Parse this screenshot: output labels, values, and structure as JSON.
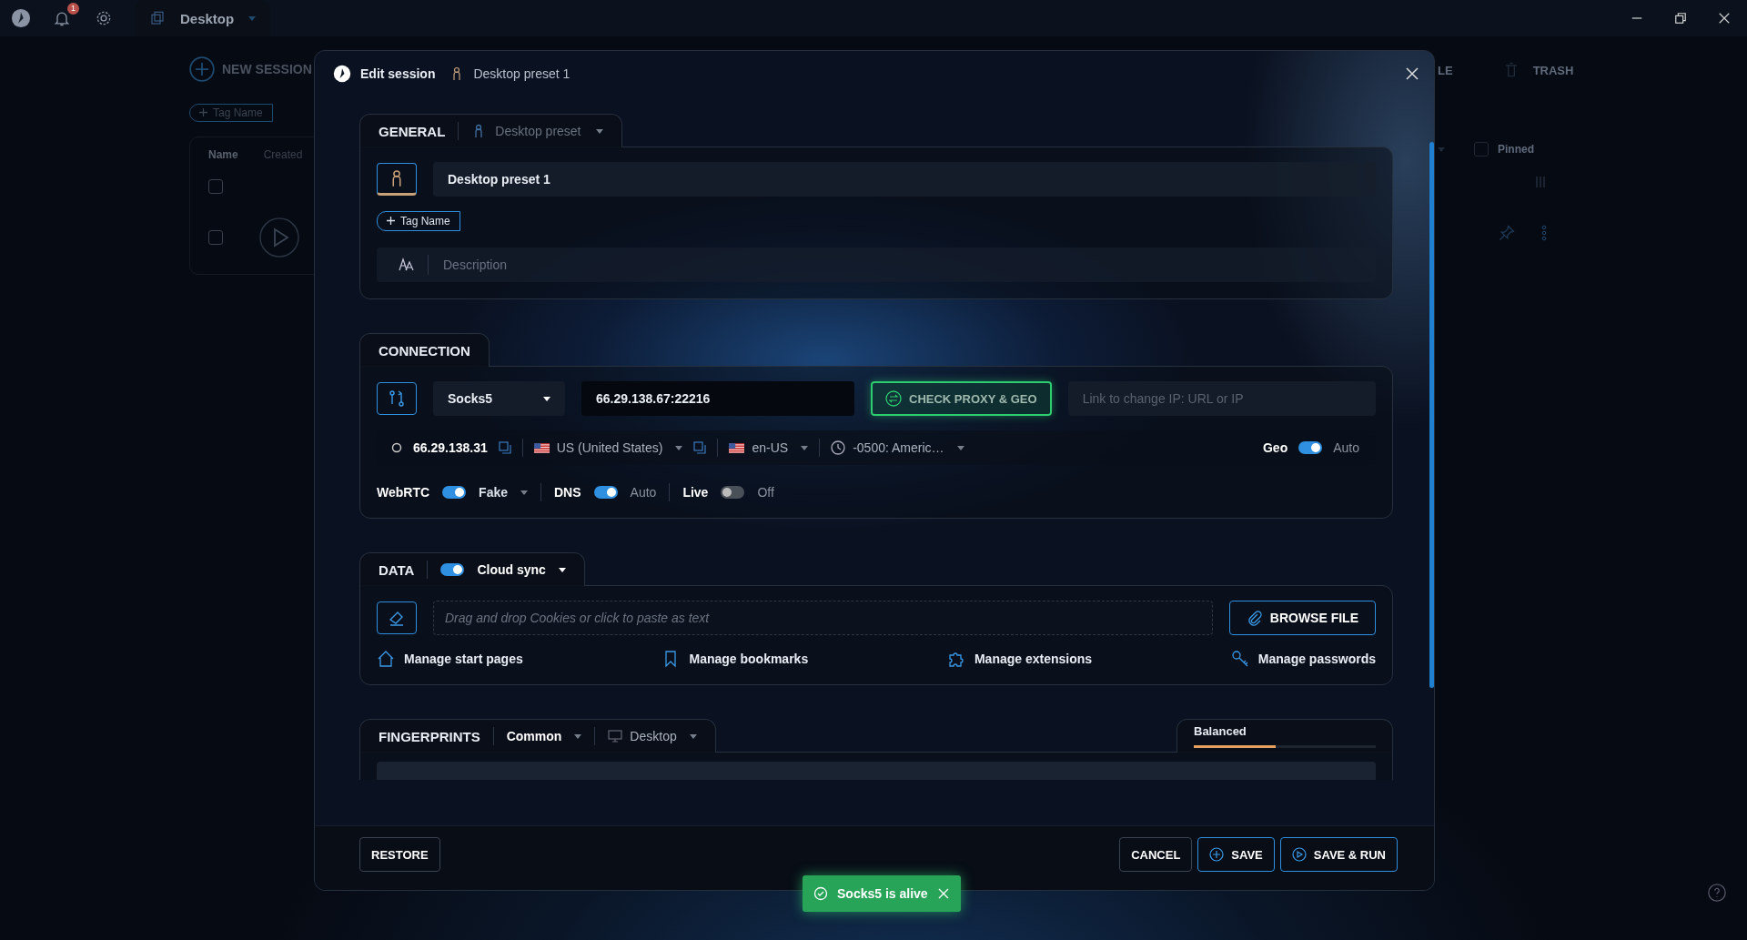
{
  "top_bar": {
    "notification_count": "1",
    "tab_title": "Desktop"
  },
  "background": {
    "new_session": "NEW SESSION",
    "tag_button": "Tag Name",
    "columns": [
      "Name",
      "Created"
    ],
    "rows": [
      {
        "kind": "plain",
        "checked": false
      },
      {
        "kind": "play",
        "checked": false
      }
    ],
    "right_tabs": [
      "LE",
      "TRASH"
    ],
    "pinned": {
      "label": "Pinned",
      "checked": false
    }
  },
  "modal": {
    "title": "Edit session",
    "preset_name": "Desktop preset 1",
    "general": {
      "title": "GENERAL",
      "preset_select": "Desktop preset",
      "name_value": "Desktop preset 1",
      "tag_button": "Tag Name",
      "description_placeholder": "Description"
    },
    "connection": {
      "title": "CONNECTION",
      "proxy_type": "Socks5",
      "proxy_address": "66.29.138.67:22216",
      "check_button": "CHECK PROXY & GEO",
      "change_ip_placeholder": "Link to change IP: URL or IP",
      "ip": "66.29.138.31",
      "country": "US (United States)",
      "language": "en-US",
      "timezone": "-0500: Americ…",
      "geo": {
        "label": "Geo",
        "on": true,
        "value": "Auto"
      },
      "toggles": [
        {
          "label": "WebRTC",
          "on": true,
          "value": "Fake",
          "kind": "dropdown"
        },
        {
          "label": "DNS",
          "on": true,
          "value": "Auto",
          "kind": "plain"
        },
        {
          "label": "Live",
          "on": false,
          "value": "Off",
          "kind": "plain"
        }
      ]
    },
    "data": {
      "title": "DATA",
      "cloud_sync": {
        "label": "Cloud sync",
        "on": true
      },
      "cookies_placeholder": "Drag and drop Cookies or click to paste as text",
      "browse_button": "BROWSE FILE",
      "links": [
        {
          "label": "Manage start pages",
          "kind": "home"
        },
        {
          "label": "Manage bookmarks",
          "kind": "bookmark"
        },
        {
          "label": "Manage extensions",
          "kind": "puzzle"
        },
        {
          "label": "Manage passwords",
          "kind": "key"
        }
      ]
    },
    "fingerprints": {
      "title": "FINGERPRINTS",
      "mode": "Common",
      "device": "Desktop",
      "profile": {
        "label": "Balanced",
        "level": 0.45
      }
    },
    "footer": {
      "restore": "RESTORE",
      "cancel": "CANCEL",
      "save": "SAVE",
      "save_run": "SAVE & RUN"
    }
  },
  "toast": {
    "message": "Socks5 is alive"
  }
}
